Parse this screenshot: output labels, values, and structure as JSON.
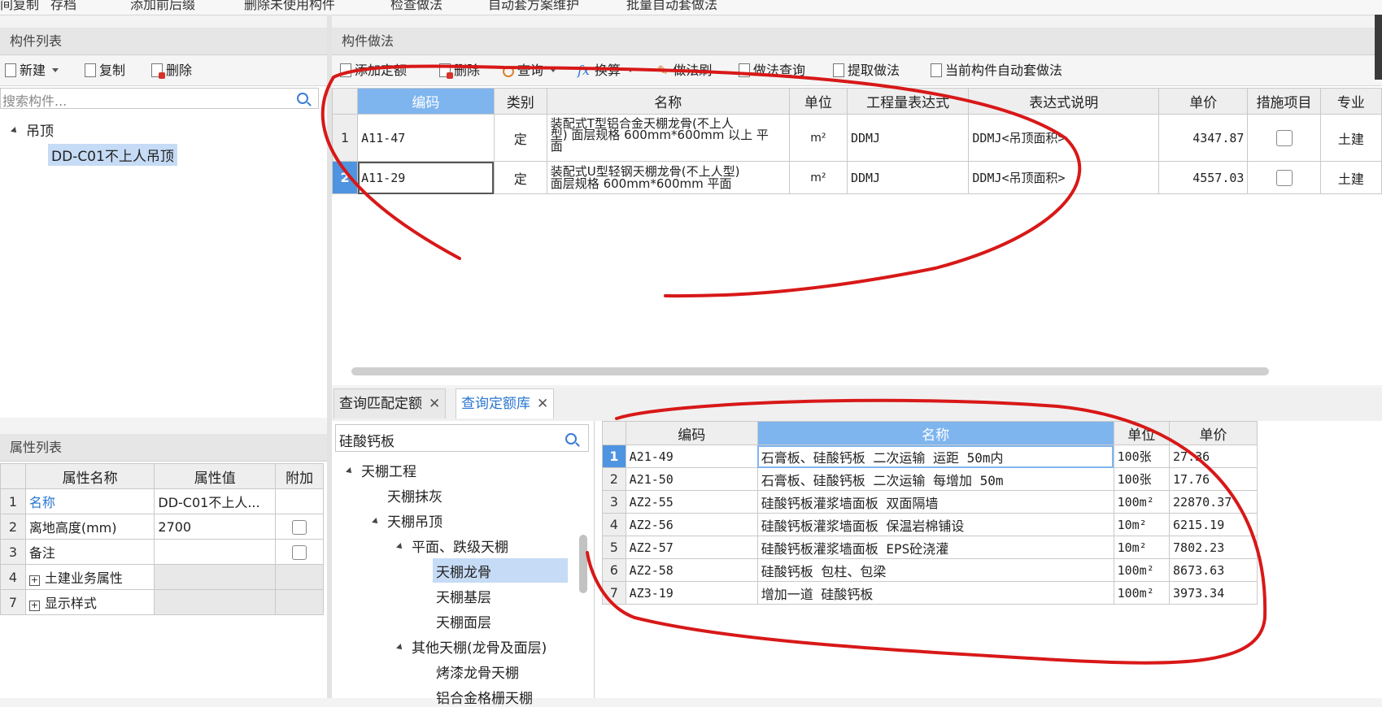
{
  "top_toolbar": [
    "间复制",
    "存档",
    "添加前后缀",
    "删除未使用构件",
    "检查做法",
    "自动套方案维护",
    "批量自动套做法"
  ],
  "component_list": {
    "title": "构件列表",
    "toolbar": {
      "new": "新建",
      "copy": "复制",
      "delete": "删除"
    },
    "search_placeholder": "搜索构件...",
    "tree": {
      "root": "吊顶",
      "child": "DD-C01不上人吊顶"
    }
  },
  "property_list": {
    "title": "属性列表",
    "headers": [
      "属性名称",
      "属性值",
      "附加"
    ],
    "rows": [
      {
        "num": "1",
        "name": "名称",
        "value": "DD-C01不上人..."
      },
      {
        "num": "2",
        "name": "离地高度(mm)",
        "value": "2700"
      },
      {
        "num": "3",
        "name": "备注",
        "value": ""
      },
      {
        "num": "4",
        "name": "土建业务属性",
        "value": ""
      },
      {
        "num": "7",
        "name": "显示样式",
        "value": ""
      }
    ]
  },
  "method_panel": {
    "title": "构件做法",
    "toolbar": [
      "添加定额",
      "删除",
      "查询",
      "换算",
      "做法刷",
      "做法查询",
      "提取做法",
      "当前构件自动套做法"
    ],
    "headers": [
      "编码",
      "类别",
      "名称",
      "单位",
      "工程量表达式",
      "表达式说明",
      "单价",
      "措施项目",
      "专业"
    ],
    "rows": [
      {
        "num": "1",
        "code": "A11-47",
        "type": "定",
        "name_lines": [
          "装配式T型铝合金天棚龙骨(不上人",
          "型) 面层规格 600mm*600mm 以上 平",
          "面"
        ],
        "unit": "m²",
        "expr": "DDMJ",
        "desc": "DDMJ<吊顶面积>",
        "price": "4347.87",
        "major": "土建"
      },
      {
        "num": "2",
        "code": "A11-29",
        "type": "定",
        "name_lines": [
          "装配式U型轻钢天棚龙骨(不上人型)",
          "面层规格 600mm*600mm 平面"
        ],
        "unit": "m²",
        "expr": "DDMJ",
        "desc": "DDMJ<吊顶面积>",
        "price": "4557.03",
        "major": "土建"
      }
    ]
  },
  "bottom_tabs": [
    "查询匹配定额",
    "查询定额库"
  ],
  "library_search": {
    "value": "硅酸钙板"
  },
  "library_tree": [
    "天棚工程",
    "天棚抹灰",
    "天棚吊顶",
    "平面、跌级天棚",
    "天棚龙骨",
    "天棚基层",
    "天棚面层",
    "其他天棚(龙骨及面层)",
    "烤漆龙骨天棚",
    "铝合金格栅天棚"
  ],
  "quota_table": {
    "headers": [
      "编码",
      "名称",
      "单位",
      "单价"
    ],
    "rows": [
      {
        "num": "1",
        "code": "A21-49",
        "name": "石膏板、硅酸钙板 二次运输 运距 50m内",
        "unit": "100张",
        "price": "27.36"
      },
      {
        "num": "2",
        "code": "A21-50",
        "name": "石膏板、硅酸钙板 二次运输 每增加 50m",
        "unit": "100张",
        "price": "17.76"
      },
      {
        "num": "3",
        "code": "AZ2-55",
        "name": "硅酸钙板灌浆墙面板 双面隔墙",
        "unit": "100m²",
        "price": "22870.37"
      },
      {
        "num": "4",
        "code": "AZ2-56",
        "name": "硅酸钙板灌浆墙面板 保温岩棉铺设",
        "unit": "10m²",
        "price": "6215.19"
      },
      {
        "num": "5",
        "code": "AZ2-57",
        "name": "硅酸钙板灌浆墙面板 EPS砼浇灌",
        "unit": "10m²",
        "price": "7802.23"
      },
      {
        "num": "6",
        "code": "AZ2-58",
        "name": "硅酸钙板 包柱、包梁",
        "unit": "100m²",
        "price": "8673.63"
      },
      {
        "num": "7",
        "code": "AZ3-19",
        "name": "增加一道 硅酸钙板",
        "unit": "100m²",
        "price": "3973.34"
      }
    ]
  },
  "colors": {
    "accent": "#2b76d1",
    "selected_header": "#7fb5ef",
    "annotation": "#d81818"
  }
}
